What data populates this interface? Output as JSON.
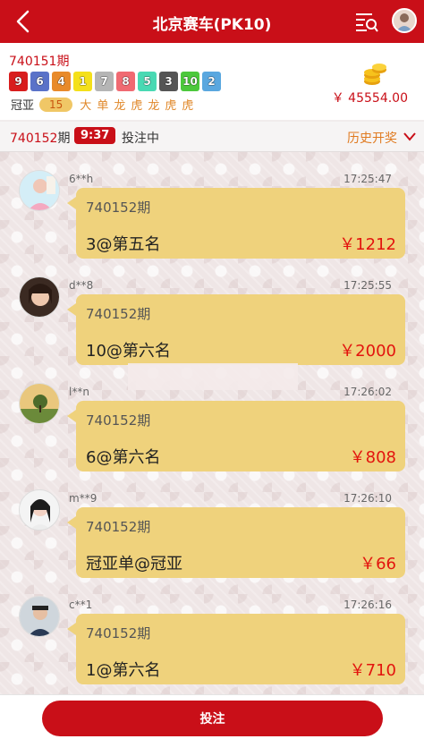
{
  "header": {
    "title": "北京赛车(PK10)",
    "back_icon": "chevron-left-icon",
    "list_icon": "list-search-icon",
    "user_icon": "avatar"
  },
  "result": {
    "period": "740151期",
    "balls": [
      {
        "num": "9",
        "color": "#d81d1d"
      },
      {
        "num": "6",
        "color": "#5a72c8"
      },
      {
        "num": "4",
        "color": "#e88a2a"
      },
      {
        "num": "1",
        "color": "#f4e01a"
      },
      {
        "num": "7",
        "color": "#b5b5b5"
      },
      {
        "num": "8",
        "color": "#f06a72"
      },
      {
        "num": "5",
        "color": "#49d9b3"
      },
      {
        "num": "3",
        "color": "#555555"
      },
      {
        "num": "10",
        "color": "#4cc83c"
      },
      {
        "num": "2",
        "color": "#5aa7df"
      }
    ],
    "stats_label": "冠亚",
    "sum": "15",
    "tags": [
      "大",
      "单",
      "龙",
      "虎",
      "龙",
      "虎",
      "虎"
    ],
    "balance": "￥ 45554.00",
    "coins_icon": "coins-icon"
  },
  "bar": {
    "current_period": "740152",
    "period_suffix": "期",
    "timer": "9:37",
    "status": "投注中",
    "history": "历史开奖",
    "chevron_icon": "chevron-down-icon"
  },
  "messages": [
    {
      "user": "6**h",
      "time": "17:25:47",
      "period": "740152期",
      "bet": "3@第五名",
      "amount": "￥1212"
    },
    {
      "user": "d**8",
      "time": "17:25:55",
      "period": "740152期",
      "bet": "10@第六名",
      "amount": "￥2000"
    },
    {
      "user": "l**n",
      "time": "17:26:02",
      "period": "740152期",
      "bet": "6@第六名",
      "amount": "￥808"
    },
    {
      "user": "m**9",
      "time": "17:26:10",
      "period": "740152期",
      "bet": "冠亚单@冠亚",
      "amount": "￥66"
    },
    {
      "user": "c**1",
      "time": "17:26:16",
      "period": "740152期",
      "bet": "1@第六名",
      "amount": "￥710"
    }
  ],
  "footer": {
    "bet_label": "投注"
  },
  "colors": {
    "brand_red": "#c90f18",
    "bubble": "#efd27c",
    "amount_red": "#e3140e"
  }
}
